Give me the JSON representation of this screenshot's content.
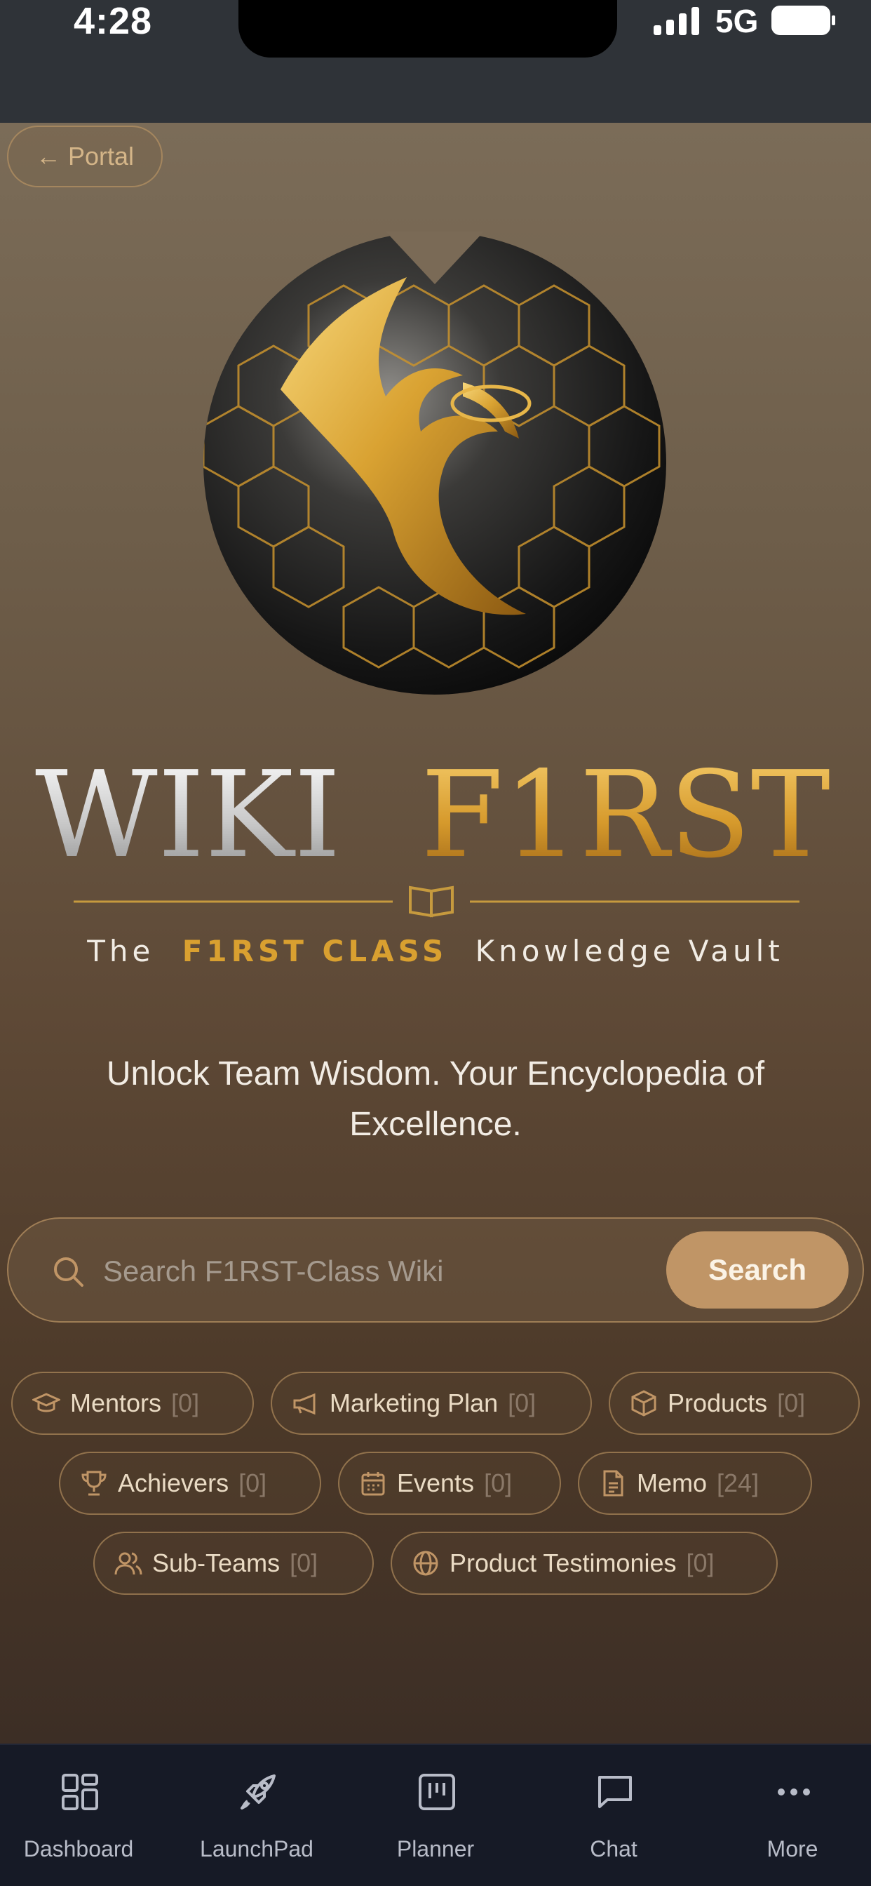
{
  "status_bar": {
    "time": "4:28",
    "network": "5G"
  },
  "header": {
    "portal_label": "← Portal"
  },
  "brand": {
    "name_part1": "WIKI",
    "name_part2": "F1RST",
    "tagline_prefix": "The",
    "tagline_highlight": "F1RST CLASS",
    "tagline_suffix": "Knowledge Vault"
  },
  "hero": {
    "subtitle": "Unlock Team Wisdom. Your Encyclopedia of Excellence."
  },
  "search": {
    "placeholder": "Search F1RST-Class Wiki",
    "button_label": "Search"
  },
  "categories": [
    {
      "label": "Mentors",
      "count": "[0]",
      "icon": "graduation-cap-icon"
    },
    {
      "label": "Marketing Plan",
      "count": "[0]",
      "icon": "megaphone-icon"
    },
    {
      "label": "Products",
      "count": "[0]",
      "icon": "package-icon"
    },
    {
      "label": "Achievers",
      "count": "[0]",
      "icon": "trophy-icon"
    },
    {
      "label": "Events",
      "count": "[0]",
      "icon": "calendar-icon"
    },
    {
      "label": "Memo",
      "count": "[24]",
      "icon": "document-icon"
    },
    {
      "label": "Sub-Teams",
      "count": "[0]",
      "icon": "users-icon"
    },
    {
      "label": "Product Testimonies",
      "count": "[0]",
      "icon": "globe-icon"
    }
  ],
  "bottom_nav": [
    {
      "label": "Dashboard",
      "icon": "grid-icon"
    },
    {
      "label": "LaunchPad",
      "icon": "rocket-icon"
    },
    {
      "label": "Planner",
      "icon": "kanban-icon"
    },
    {
      "label": "Chat",
      "icon": "chat-bubble-icon"
    },
    {
      "label": "More",
      "icon": "more-dots-icon"
    }
  ],
  "colors": {
    "accent_gold": "#c09566",
    "nav_bg": "#161a26",
    "status_bg": "#2f3338"
  }
}
